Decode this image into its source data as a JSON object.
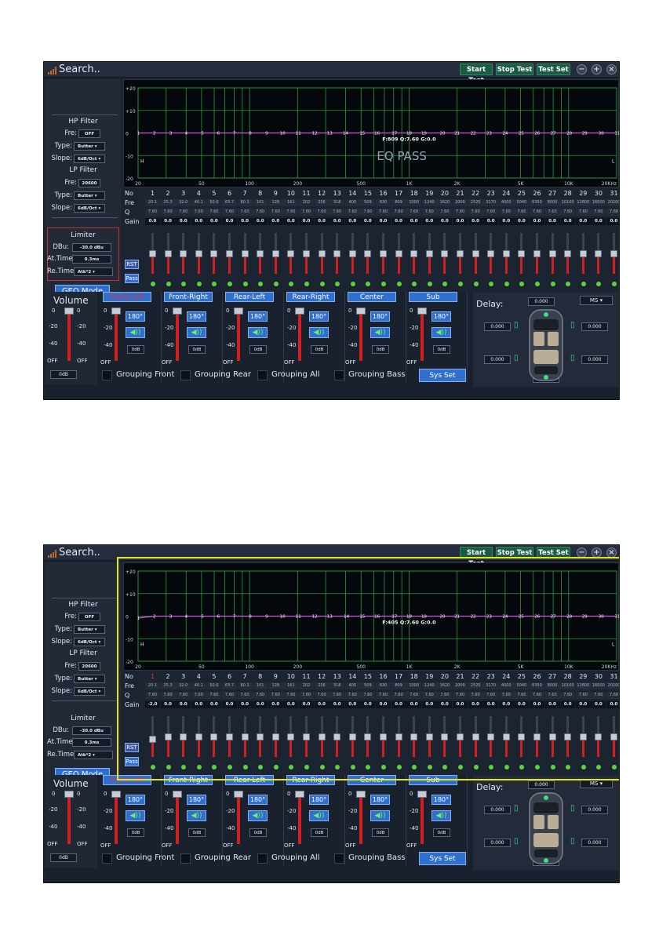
{
  "screens": [
    {
      "app_title": "Search..",
      "toolbar": {
        "start_test": "Start Test",
        "stop_test": "Stop Test",
        "test_set": "Test Set"
      },
      "window_controls": {
        "minimize_icon": "minus-circle",
        "maximize_icon": "plus-circle",
        "close_icon": "x-circle"
      },
      "hp_filter": {
        "title": "HP Filter",
        "fre_label": "Fre:",
        "fre_value": "OFF",
        "type_label": "Type:",
        "type_value": "Butter",
        "slope_label": "Slope:",
        "slope_value": "6dB/Oct"
      },
      "lp_filter": {
        "title": "LP Filter",
        "fre_label": "Fre:",
        "fre_value": "20600",
        "type_label": "Type:",
        "type_value": "Butter",
        "slope_label": "Slope:",
        "slope_value": "6dB/Oct"
      },
      "limiter": {
        "title": "Limiter",
        "dbu_label": "DBu:",
        "dbu_value": "-30.0 dBu",
        "attime_label": "At.Time:",
        "attime_value": "0.3ms",
        "retime_label": "Re.Time:",
        "retime_value": "Atk*2",
        "highlighted": true
      },
      "geq_mode": "GEQ Mode",
      "graph": {
        "y_labels": [
          "+20",
          "+10",
          "0",
          "-10",
          "-20"
        ],
        "x_labels": [
          "20",
          "50",
          "100",
          "200",
          "500",
          "1K",
          "2K",
          "5K",
          "10K",
          "20KHz"
        ],
        "band_numbers": [
          "1",
          "2",
          "3",
          "4",
          "5",
          "6",
          "7",
          "8",
          "9",
          "10",
          "11",
          "12",
          "13",
          "14",
          "15",
          "16",
          "17",
          "18",
          "19",
          "20",
          "21",
          "22",
          "23",
          "24",
          "25",
          "26",
          "27",
          "28",
          "29",
          "30",
          "31"
        ],
        "readout": "F:809 Q:7.60 G:0.0",
        "overlay": "EQ PASS",
        "h_marker": "H",
        "l_marker": "L",
        "curve_color": "#d05ad8"
      },
      "table": {
        "no_label": "No",
        "fre_label": "Fre",
        "q_label": "Q",
        "gain_label": "Gain",
        "selected_band": null,
        "no": [
          "1",
          "2",
          "3",
          "4",
          "5",
          "6",
          "7",
          "8",
          "9",
          "10",
          "11",
          "12",
          "13",
          "14",
          "15",
          "16",
          "17",
          "18",
          "19",
          "20",
          "21",
          "22",
          "23",
          "24",
          "25",
          "26",
          "27",
          "28",
          "29",
          "30",
          "31"
        ],
        "fre": [
          "20.1",
          "25.3",
          "32.0",
          "40.1",
          "50.6",
          "63.7",
          "80.3",
          "101",
          "128",
          "161",
          "202",
          "256",
          "318",
          "400",
          "509",
          "630",
          "809",
          "1000",
          "1240",
          "1620",
          "2000",
          "2520",
          "3170",
          "4000",
          "5040",
          "6350",
          "8000",
          "10100",
          "12600",
          "16000",
          "20200"
        ],
        "q": [
          "7.60",
          "7.60",
          "7.60",
          "7.60",
          "7.60",
          "7.60",
          "7.60",
          "7.60",
          "7.60",
          "7.60",
          "7.60",
          "7.60",
          "7.60",
          "7.60",
          "7.60",
          "7.60",
          "7.60",
          "7.60",
          "7.60",
          "7.60",
          "7.60",
          "7.60",
          "7.60",
          "7.60",
          "7.60",
          "7.60",
          "7.60",
          "7.60",
          "7.60",
          "7.60",
          "7.60"
        ],
        "gain": [
          "0.0",
          "0.0",
          "0.0",
          "0.0",
          "0.0",
          "0.0",
          "0.0",
          "0.0",
          "0.0",
          "0.0",
          "0.0",
          "0.0",
          "0.0",
          "0.0",
          "0.0",
          "0.0",
          "0.0",
          "0.0",
          "0.0",
          "0.0",
          "0.0",
          "0.0",
          "0.0",
          "0.0",
          "0.0",
          "0.0",
          "0.0",
          "0.0",
          "0.0",
          "0.0",
          "0.0"
        ]
      },
      "rst": "RST",
      "pass": "Pass",
      "volume": {
        "title": "Volume",
        "ticks_left": [
          "0",
          "-20",
          "-40",
          "OFF"
        ],
        "ticks_right": [
          "0",
          "-20",
          "-40",
          "OFF"
        ],
        "value": "0dB",
        "level": 1.0
      },
      "channels": [
        {
          "name": "Front-Left",
          "phase": "180°",
          "value": "0dB",
          "ticks": [
            "0",
            "-20",
            "-40",
            "OFF"
          ],
          "selected": true,
          "level": 1.0
        },
        {
          "name": "Front-Right",
          "phase": "180°",
          "value": "0dB",
          "ticks": [
            "0",
            "-20",
            "-40",
            "OFF"
          ],
          "selected": false,
          "level": 1.0
        },
        {
          "name": "Rear-Left",
          "phase": "180°",
          "value": "0dB",
          "ticks": [
            "0",
            "-20",
            "-40",
            "OFF"
          ],
          "selected": false,
          "level": 1.0
        },
        {
          "name": "Rear-Right",
          "phase": "180°",
          "value": "0dB",
          "ticks": [
            "0",
            "-20",
            "-40",
            "OFF"
          ],
          "selected": false,
          "level": 1.0
        },
        {
          "name": "Center",
          "phase": "180°",
          "value": "0dB",
          "ticks": [
            "0",
            "-20",
            "-40",
            "OFF"
          ],
          "selected": false,
          "level": 1.0
        },
        {
          "name": "Sub",
          "phase": "180°",
          "value": "0dB",
          "ticks": [
            "0",
            "-20",
            "-40",
            "OFF"
          ],
          "selected": false,
          "level": 1.0
        }
      ],
      "grouping": [
        "Grouping Front",
        "Grouping Rear",
        "Grouping All",
        "Grouping Bass"
      ],
      "sys_set": "Sys Set",
      "delay": {
        "title": "Delay:",
        "unit": "MS",
        "top": "0.000",
        "front_left": "0.000",
        "front_right": "0.000",
        "rear_left": "0.000",
        "rear_right": "0.000",
        "bottom": "0.000"
      }
    },
    {
      "app_title": "Search..",
      "toolbar": {
        "start_test": "Start Test",
        "stop_test": "Stop Test",
        "test_set": "Test Set"
      },
      "window_controls": {
        "minimize_icon": "minus-circle",
        "maximize_icon": "plus-circle",
        "close_icon": "x-circle"
      },
      "hp_filter": {
        "title": "HP Filter",
        "fre_label": "Fre:",
        "fre_value": "OFF",
        "type_label": "Type:",
        "type_value": "Butter",
        "slope_label": "Slope:",
        "slope_value": "6dB/Oct"
      },
      "lp_filter": {
        "title": "LP Filter",
        "fre_label": "Fre:",
        "fre_value": "20600",
        "type_label": "Type:",
        "type_value": "Butter",
        "slope_label": "Slope:",
        "slope_value": "6dB/Oct"
      },
      "limiter": {
        "title": "Limiter",
        "dbu_label": "DBu:",
        "dbu_value": "-30.0 dBu",
        "attime_label": "At.Time:",
        "attime_value": "0.3ms",
        "retime_label": "Re.Time:",
        "retime_value": "Atk*2",
        "highlighted": false
      },
      "geq_mode": "GEQ Mode",
      "graph": {
        "y_labels": [
          "+20",
          "+10",
          "0",
          "-10",
          "-20"
        ],
        "x_labels": [
          "20",
          "50",
          "100",
          "200",
          "500",
          "1K",
          "2K",
          "5K",
          "10K",
          "20KHz"
        ],
        "band_numbers": [
          "1",
          "2",
          "3",
          "4",
          "5",
          "6",
          "7",
          "8",
          "9",
          "10",
          "11",
          "12",
          "13",
          "14",
          "15",
          "16",
          "17",
          "18",
          "19",
          "20",
          "21",
          "22",
          "23",
          "24",
          "25",
          "26",
          "27",
          "28",
          "29",
          "30",
          "31"
        ],
        "readout": "F:405 Q:7.60 G:0.0",
        "overlay": "",
        "h_marker": "H",
        "l_marker": "L",
        "curve_color": "#d05ad8"
      },
      "table": {
        "no_label": "No",
        "fre_label": "Fre",
        "q_label": "Q",
        "gain_label": "Gain",
        "selected_band": 0,
        "no": [
          "1",
          "2",
          "3",
          "4",
          "5",
          "6",
          "7",
          "8",
          "9",
          "10",
          "11",
          "12",
          "13",
          "14",
          "15",
          "16",
          "17",
          "18",
          "19",
          "20",
          "21",
          "22",
          "23",
          "24",
          "25",
          "26",
          "27",
          "28",
          "29",
          "30",
          "31"
        ],
        "fre": [
          "20.1",
          "25.3",
          "32.0",
          "40.1",
          "50.6",
          "63.7",
          "80.3",
          "101",
          "128",
          "161",
          "202",
          "256",
          "318",
          "405",
          "509",
          "630",
          "809",
          "1000",
          "1240",
          "1620",
          "2000",
          "2520",
          "3170",
          "4000",
          "5040",
          "6350",
          "8000",
          "10100",
          "12600",
          "16000",
          "20200"
        ],
        "q": [
          "7.60",
          "7.60",
          "7.60",
          "7.60",
          "7.60",
          "7.60",
          "7.60",
          "7.60",
          "7.60",
          "7.60",
          "7.60",
          "7.60",
          "7.60",
          "7.60",
          "7.60",
          "7.60",
          "7.60",
          "7.60",
          "7.60",
          "7.60",
          "7.60",
          "7.60",
          "7.60",
          "7.60",
          "7.60",
          "7.60",
          "7.60",
          "7.60",
          "7.60",
          "7.60",
          "7.60"
        ],
        "gain": [
          "-2.0",
          "0.0",
          "0.0",
          "0.0",
          "0.0",
          "0.0",
          "0.0",
          "0.0",
          "0.0",
          "0.0",
          "0.0",
          "0.0",
          "0.0",
          "0.0",
          "0.0",
          "0.0",
          "0.0",
          "0.0",
          "0.0",
          "0.0",
          "0.0",
          "0.0",
          "0.0",
          "0.0",
          "0.0",
          "0.0",
          "0.0",
          "0.0",
          "0.0",
          "0.0",
          "0.0"
        ]
      },
      "rst": "RST",
      "pass": "Pass",
      "volume": {
        "title": "Volume",
        "ticks_left": [
          "0",
          "-20",
          "-40",
          "OFF"
        ],
        "ticks_right": [
          "0",
          "-20",
          "-40",
          "OFF"
        ],
        "value": "0dB",
        "level": 1.0
      },
      "channels": [
        {
          "name": "Front-Left",
          "phase": "180°",
          "value": "0dB",
          "ticks": [
            "0",
            "-20",
            "-40",
            "OFF"
          ],
          "selected": true,
          "level": 1.0
        },
        {
          "name": "Front-Right",
          "phase": "180°",
          "value": "0dB",
          "ticks": [
            "0",
            "-20",
            "-40",
            "OFF"
          ],
          "selected": false,
          "level": 1.0
        },
        {
          "name": "Rear-Left",
          "phase": "180°",
          "value": "0dB",
          "ticks": [
            "0",
            "-20",
            "-40",
            "OFF"
          ],
          "selected": false,
          "level": 1.0
        },
        {
          "name": "Rear-Right",
          "phase": "180°",
          "value": "0dB",
          "ticks": [
            "0",
            "-20",
            "-40",
            "OFF"
          ],
          "selected": false,
          "level": 1.0
        },
        {
          "name": "Center",
          "phase": "180°",
          "value": "0dB",
          "ticks": [
            "0",
            "-20",
            "-40",
            "OFF"
          ],
          "selected": false,
          "level": 1.0
        },
        {
          "name": "Sub",
          "phase": "180°",
          "value": "0dB",
          "ticks": [
            "0",
            "-20",
            "-40",
            "OFF"
          ],
          "selected": false,
          "level": 1.0
        }
      ],
      "grouping": [
        "Grouping Front",
        "Grouping Rear",
        "Grouping All",
        "Grouping Bass"
      ],
      "sys_set": "Sys Set",
      "delay": {
        "title": "Delay:",
        "unit": "MS",
        "top": "0.000",
        "front_left": "0.000",
        "front_right": "0.000",
        "rear_left": "0.000",
        "rear_right": "0.000",
        "bottom": "0.000"
      }
    }
  ]
}
